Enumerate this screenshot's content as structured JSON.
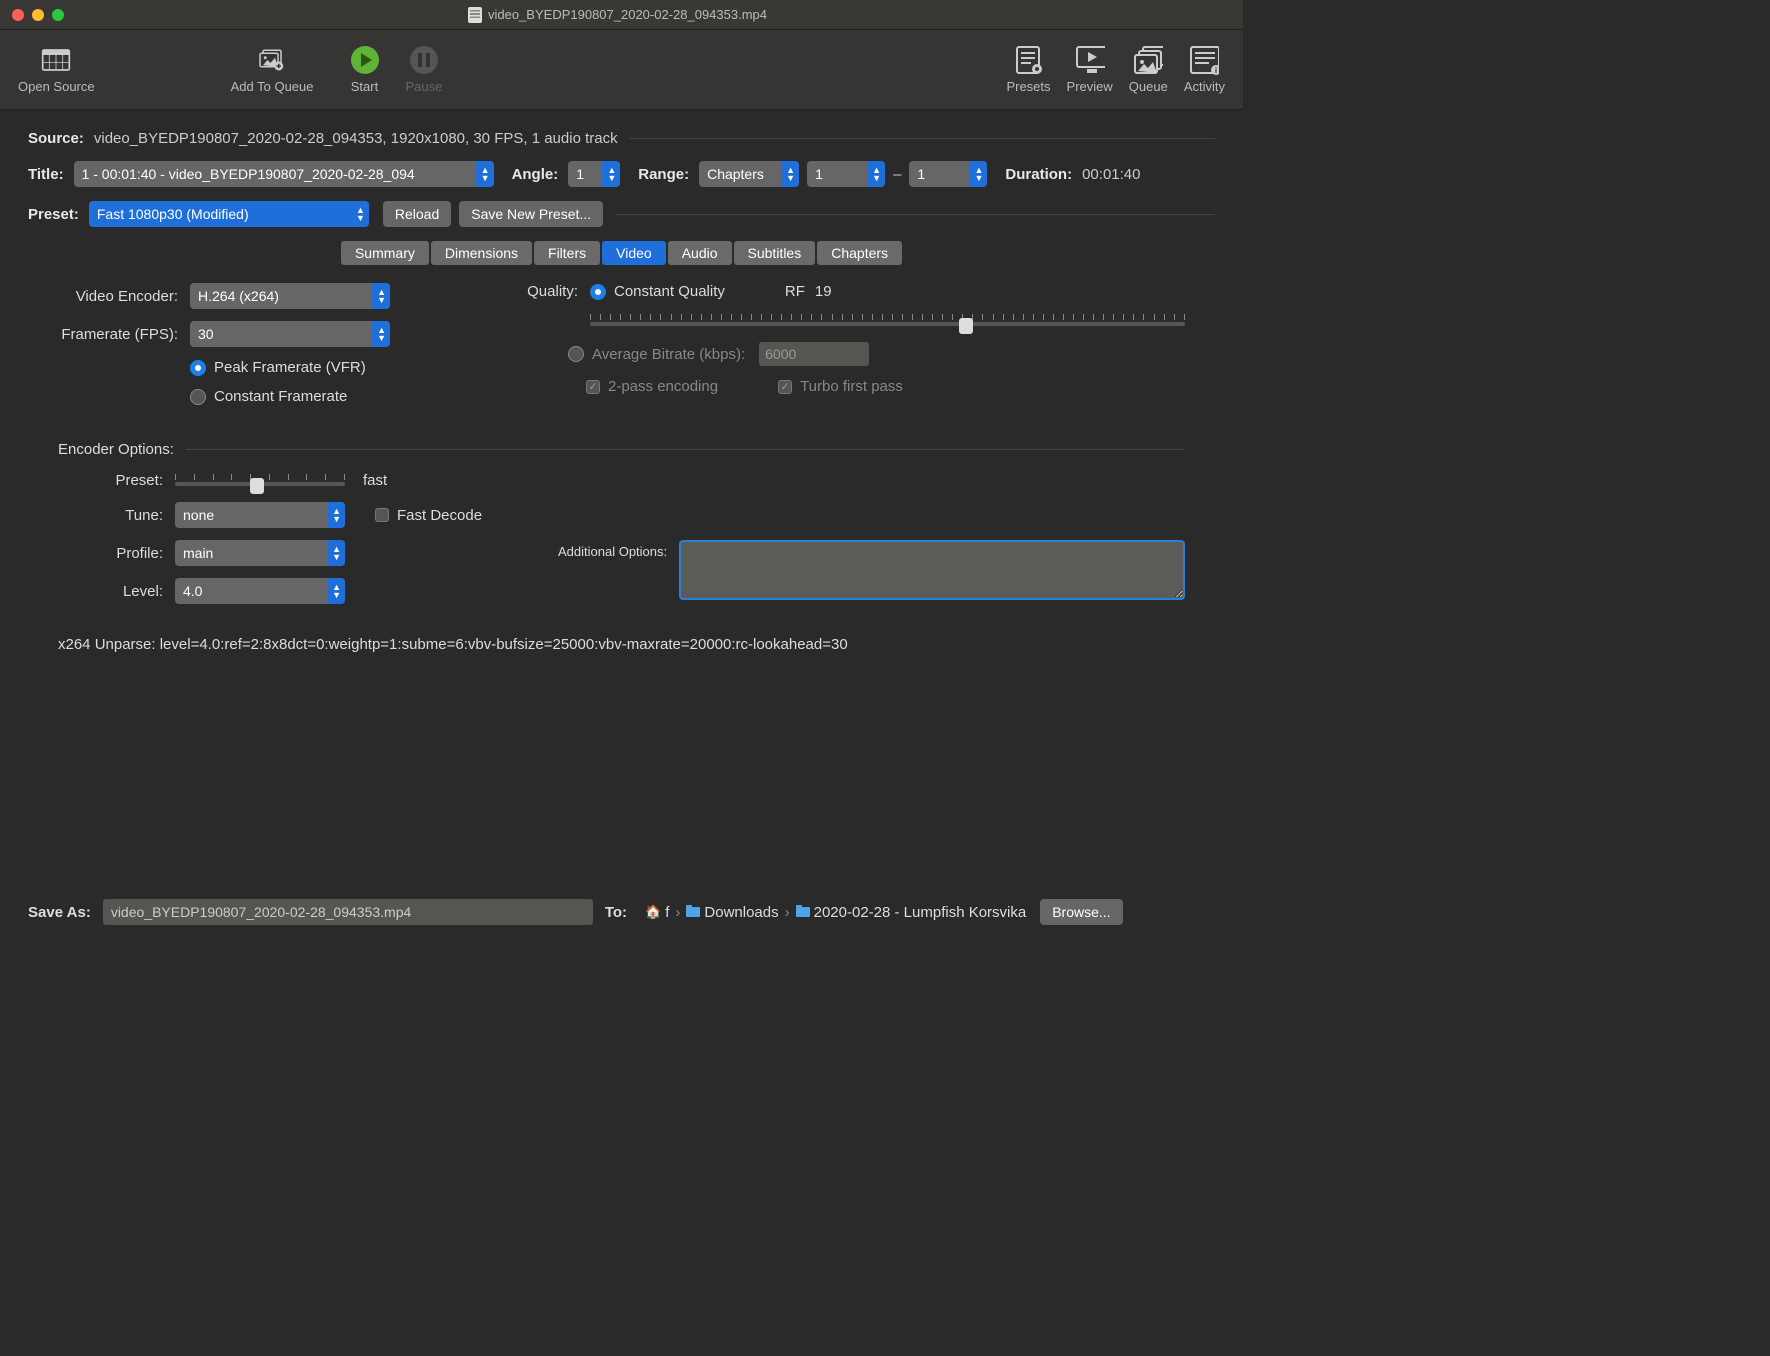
{
  "window": {
    "title": "video_BYEDP190807_2020-02-28_094353.mp4"
  },
  "toolbar": {
    "open_source": "Open Source",
    "add_to_queue": "Add To Queue",
    "start": "Start",
    "pause": "Pause",
    "presets": "Presets",
    "preview": "Preview",
    "queue": "Queue",
    "activity": "Activity"
  },
  "source": {
    "label": "Source:",
    "value": "video_BYEDP190807_2020-02-28_094353, 1920x1080, 30 FPS, 1 audio track"
  },
  "title_row": {
    "label": "Title:",
    "value": "1 - 00:01:40 - video_BYEDP190807_2020-02-28_094",
    "angle_label": "Angle:",
    "angle_value": "1",
    "range_label": "Range:",
    "range_type": "Chapters",
    "range_from": "1",
    "range_sep": "–",
    "range_to": "1",
    "duration_label": "Duration:",
    "duration_value": "00:01:40"
  },
  "preset_row": {
    "label": "Preset:",
    "value": "Fast 1080p30 (Modified)",
    "reload": "Reload",
    "save_new": "Save New Preset..."
  },
  "tabs": [
    "Summary",
    "Dimensions",
    "Filters",
    "Video",
    "Audio",
    "Subtitles",
    "Chapters"
  ],
  "active_tab": "Video",
  "video": {
    "encoder_label": "Video Encoder:",
    "encoder_value": "H.264 (x264)",
    "fps_label": "Framerate (FPS):",
    "fps_value": "30",
    "peak_fps": "Peak Framerate (VFR)",
    "constant_fps": "Constant Framerate",
    "quality_label": "Quality:",
    "constant_quality": "Constant Quality",
    "rf_label": "RF",
    "rf_value": "19",
    "avg_bitrate": "Average Bitrate (kbps):",
    "bitrate_value": "6000",
    "two_pass": "2-pass encoding",
    "turbo": "Turbo first pass",
    "encoder_options_label": "Encoder Options:",
    "preset_label": "Preset:",
    "preset_value": "fast",
    "tune_label": "Tune:",
    "tune_value": "none",
    "fast_decode": "Fast Decode",
    "profile_label": "Profile:",
    "profile_value": "main",
    "additional_label": "Additional Options:",
    "additional_value": "",
    "level_label": "Level:",
    "level_value": "4.0",
    "unparse": "x264 Unparse: level=4.0:ref=2:8x8dct=0:weightp=1:subme=6:vbv-bufsize=25000:vbv-maxrate=20000:rc-lookahead=30"
  },
  "save_as": {
    "label": "Save As:",
    "value": "video_BYEDP190807_2020-02-28_094353.mp4"
  },
  "to": {
    "label": "To:",
    "home": "f",
    "downloads": "Downloads",
    "folder": "2020-02-28 - Lumpfish Korsvika",
    "browse": "Browse..."
  }
}
